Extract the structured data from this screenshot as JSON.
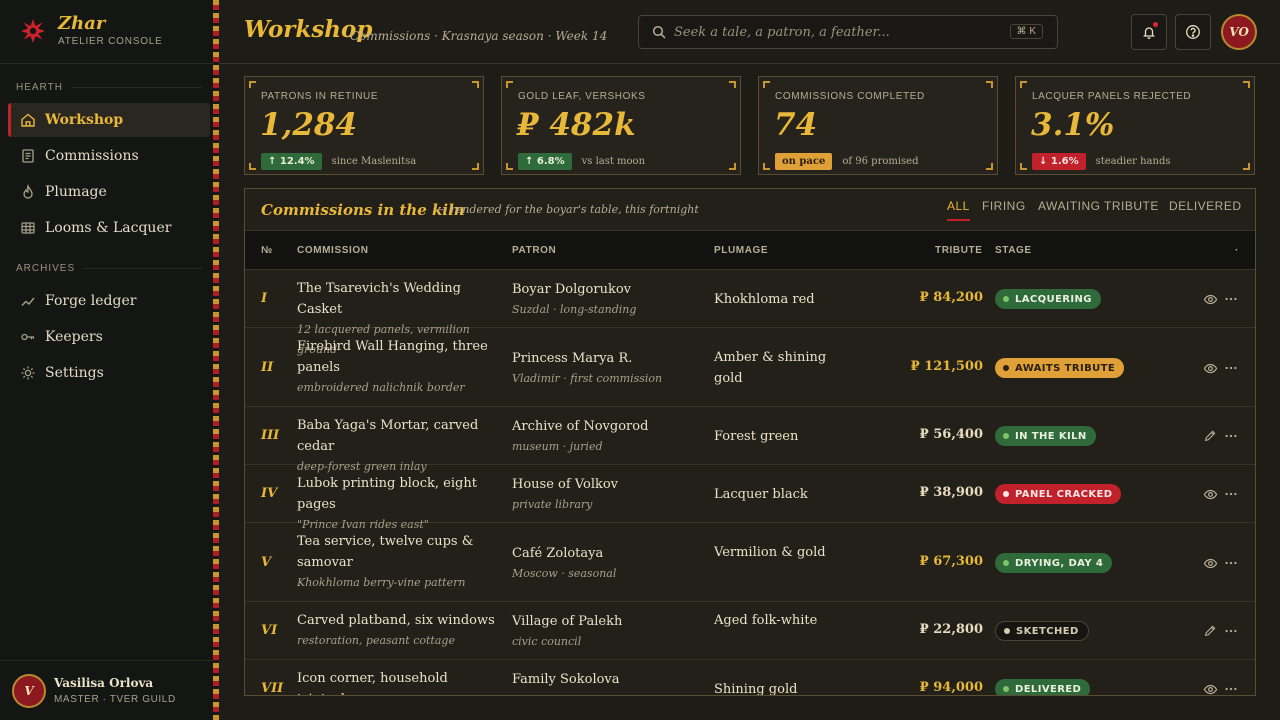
{
  "brand": {
    "name": "Zhar",
    "subtitle": "ATELIER CONSOLE"
  },
  "sidebar": {
    "sections": [
      {
        "label": "HEARTH",
        "items": [
          {
            "label": "Workshop",
            "icon": "home-icon",
            "active": true
          },
          {
            "label": "Commissions",
            "icon": "ledger-page-icon"
          },
          {
            "label": "Plumage",
            "icon": "flame-feather-icon"
          },
          {
            "label": "Looms & Lacquer",
            "icon": "grid-icon"
          }
        ]
      },
      {
        "label": "ARCHIVES",
        "items": [
          {
            "label": "Forge ledger",
            "icon": "trend-line-icon"
          },
          {
            "label": "Keepers",
            "icon": "key-icon"
          },
          {
            "label": "Settings",
            "icon": "sun-gear-icon"
          }
        ]
      }
    ],
    "user": {
      "initials": "V",
      "name": "Vasilisa Orlova",
      "role": "MASTER · TVER GUILD"
    }
  },
  "header": {
    "title": "Workshop",
    "subtitle": "Commissions · Krasnaya season · Week 14",
    "search": {
      "placeholder": "Seek a tale, a patron, a feather...",
      "shortcut": "⌘ K"
    },
    "avatar_initials": "VO"
  },
  "kpis": [
    {
      "label": "PATRONS IN RETINUE",
      "value": "1,284",
      "chip": "↑ 12.4%",
      "chip_kind": "up",
      "note": "since Maslenitsa"
    },
    {
      "label": "GOLD LEAF, VERSHOKS",
      "value": "₽ 482k",
      "chip": "↑ 6.8%",
      "chip_kind": "up",
      "note": "vs last moon"
    },
    {
      "label": "COMMISSIONS COMPLETED",
      "value": "74",
      "chip": "on pace",
      "chip_kind": "warn",
      "note": "of 96 promised"
    },
    {
      "label": "LACQUER PANELS REJECTED",
      "value": "3.1%",
      "chip": "↓ 1.6%",
      "chip_kind": "down",
      "note": "steadier hands"
    }
  ],
  "table": {
    "title": "Commissions in the kiln",
    "subtitle": "— rendered for the boyar's table, this fortnight",
    "tabs": [
      "ALL",
      "FIRING",
      "AWAITING TRIBUTE",
      "DELIVERED"
    ],
    "active_tab": "ALL",
    "columns": {
      "no": "№",
      "commission": "COMMISSION",
      "patron": "PATRON",
      "plumage": "PLUMAGE",
      "tribute": "TRIBUTE",
      "stage": "STAGE",
      "actions": "·"
    },
    "rows": [
      {
        "no": "I",
        "title": "The Tsarevich's Wedding Casket",
        "note": "12 lacquered panels, vermilion ground",
        "patron": "Boyar Dolgorukov",
        "patron_note": "Suzdal · long-standing",
        "plumage": "Khokhloma red",
        "tribute": "₽ 84,200",
        "tribute_gold": true,
        "stage": "LACQUERING",
        "stage_kind": "green",
        "action": "eye-icon"
      },
      {
        "no": "II",
        "title": "Firebird Wall Hanging, three panels",
        "note": "embroidered nalichnik border",
        "patron": "Princess Marya R.",
        "patron_note": "Vladimir · first commission",
        "plumage": "Amber & shining gold",
        "tribute": "₽ 121,500",
        "tribute_gold": true,
        "stage": "AWAITS TRIBUTE",
        "stage_kind": "amber",
        "action": "eye-icon"
      },
      {
        "no": "III",
        "title": "Baba Yaga's Mortar, carved cedar",
        "note": "deep-forest green inlay",
        "patron": "Archive of Novgorod",
        "patron_note": "museum · juried",
        "plumage": "Forest green",
        "tribute": "₽ 56,400",
        "tribute_gold": false,
        "stage": "IN THE KILN",
        "stage_kind": "green",
        "action": "pencil-icon"
      },
      {
        "no": "IV",
        "title": "Lubok printing block, eight pages",
        "note": "\"Prince Ivan rides east\"",
        "patron": "House of Volkov",
        "patron_note": "private library",
        "plumage": "Lacquer black",
        "tribute": "₽ 38,900",
        "tribute_gold": false,
        "stage": "PANEL CRACKED",
        "stage_kind": "red",
        "action": "eye-icon"
      },
      {
        "no": "V",
        "title": "Tea service, twelve cups & samovar",
        "note": "Khokhloma berry-vine pattern",
        "patron": "Café Zolotaya",
        "patron_note": "Moscow · seasonal",
        "plumage": "Vermilion & gold",
        "tribute": "₽ 67,300",
        "tribute_gold": true,
        "stage": "DRYING, DAY 4",
        "stage_kind": "green",
        "action": "eye-icon"
      },
      {
        "no": "VI",
        "title": "Carved platband, six windows",
        "note": "restoration, peasant cottage",
        "patron": "Village of Palekh",
        "patron_note": "civic council",
        "plumage": "Aged folk-white",
        "tribute": "₽ 22,800",
        "tribute_gold": false,
        "stage": "SKETCHED",
        "stage_kind": "dark",
        "action": "pencil-icon"
      },
      {
        "no": "VII",
        "title": "Icon corner, household triptych",
        "note": "",
        "patron": "Family Sokolova",
        "patron_note": "",
        "plumage": "Shining gold",
        "tribute": "₽ 94,000",
        "tribute_gold": true,
        "stage": "DELIVERED",
        "stage_kind": "green",
        "action": "eye-icon"
      }
    ]
  },
  "colors": {
    "accent_gold": "#e8b838",
    "accent_red": "#c0212b",
    "bg": "#1e1c16",
    "sidebar_bg": "#131613"
  }
}
